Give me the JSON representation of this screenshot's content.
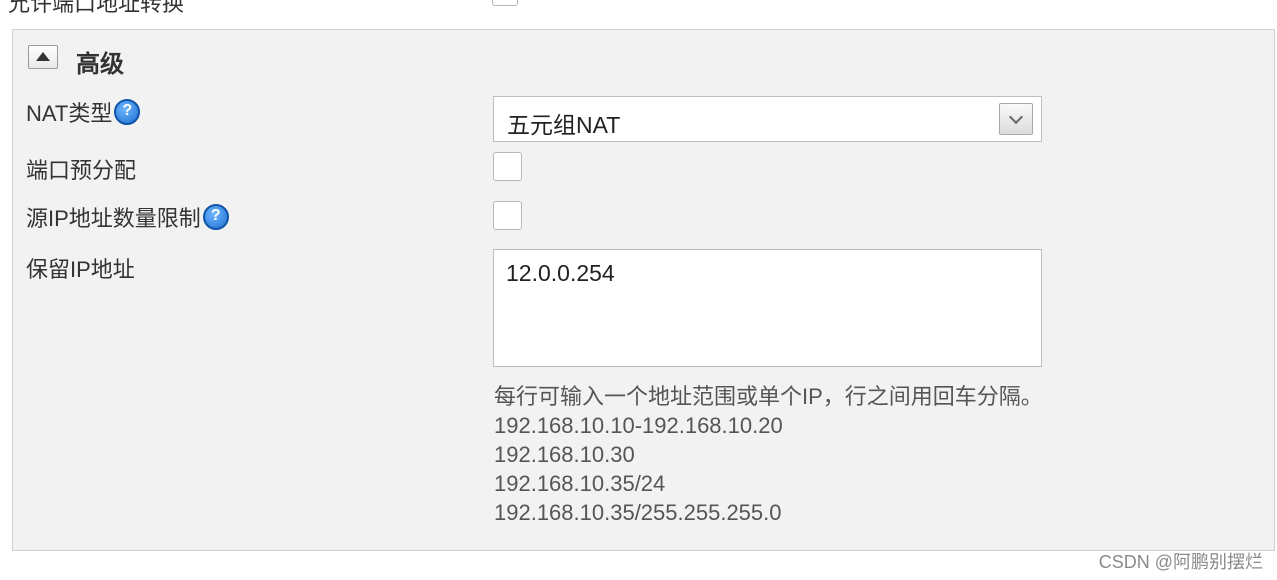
{
  "top_row": {
    "label": "允许端口地址转换"
  },
  "section": {
    "title": "高级"
  },
  "fields": {
    "nat_type": {
      "label": "NAT类型",
      "value": "五元组NAT",
      "help": "?"
    },
    "port_prealloc": {
      "label": "端口预分配",
      "checked": false
    },
    "src_ip_limit": {
      "label": "源IP地址数量限制",
      "checked": false,
      "help": "?"
    },
    "reserved_ip": {
      "label": "保留IP地址",
      "value": "12.0.0.254"
    }
  },
  "hint": {
    "lines": [
      "每行可输入一个地址范围或单个IP，行之间用回车分隔。",
      "192.168.10.10-192.168.10.20",
      "192.168.10.30",
      "192.168.10.35/24",
      "192.168.10.35/255.255.255.0"
    ]
  },
  "watermark": "CSDN @阿鹏别摆烂",
  "colors": {
    "panel_bg": "#f2f2f2",
    "help_icon": "#1d6fd0"
  }
}
